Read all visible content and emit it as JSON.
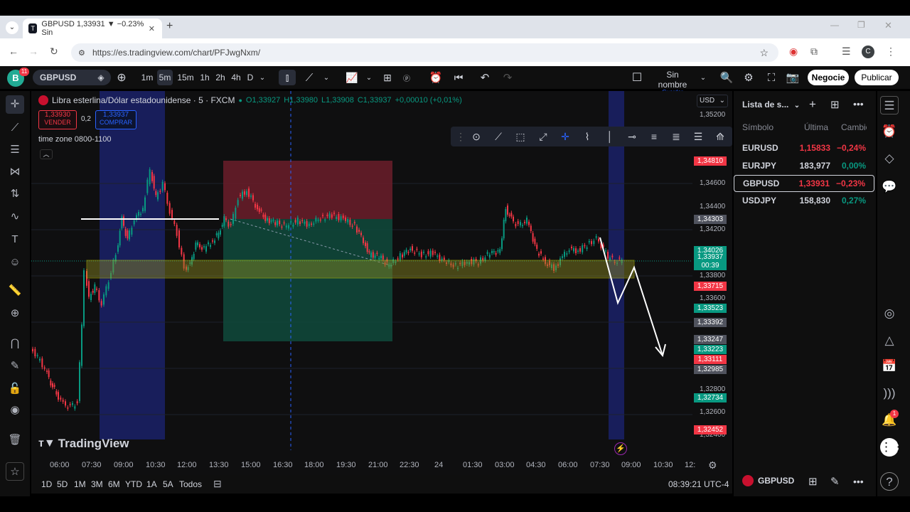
{
  "browser": {
    "tab_title": "GBPUSD 1,33931 ▼ −0.23% Sin",
    "url": "https://es.tradingview.com/chart/PFJwgNxm/",
    "profile_letter": "C"
  },
  "header": {
    "avatar_letter": "B",
    "badge_count": "11",
    "symbol": "GBPUSD",
    "intervals": [
      "1m",
      "5m",
      "15m",
      "1h",
      "2h",
      "4h",
      "D"
    ],
    "selected_interval": "5m",
    "layout_name": "Sin nombre",
    "layout_sub": "Guardar",
    "trade_button": "Negocie",
    "publish_button": "Publicar"
  },
  "chart": {
    "title": "Libra esterlina/Dólar estadounidense · 5 · FXCM",
    "ohlc": {
      "o": "O1,33927",
      "h": "H1,33980",
      "l": "L1,33908",
      "c": "C1,33937",
      "chg": "+0,00010 (+0,01%)"
    },
    "sell_price": "1,33930",
    "sell_label": "VENDER",
    "spread": "0,2",
    "buy_price": "1,33937",
    "buy_label": "COMPRAR",
    "indicator": "time zone 0800-1100",
    "currency": "USD",
    "price_ticks": [
      "1,35200",
      "1,34600",
      "1,34400",
      "1,34200",
      "1,33800",
      "1,33600",
      "1,32800",
      "1,32600",
      "1,32400"
    ],
    "price_labels": [
      {
        "text": "1,34810",
        "color": "#f23645"
      },
      {
        "text": "1,34303",
        "color": "#50535e"
      },
      {
        "text": "1,34026",
        "color": "#089981"
      },
      {
        "text": "1,33937",
        "color": "#089981"
      },
      {
        "text": "00:39",
        "color": "#089981"
      },
      {
        "text": "1,33715",
        "color": "#f23645"
      },
      {
        "text": "1,33523",
        "color": "#089981"
      },
      {
        "text": "1,33392",
        "color": "#50535e"
      },
      {
        "text": "1,33247",
        "color": "#50535e"
      },
      {
        "text": "1,33223",
        "color": "#089981"
      },
      {
        "text": "1,33111",
        "color": "#f23645"
      },
      {
        "text": "1,32985",
        "color": "#50535e"
      },
      {
        "text": "1,32734",
        "color": "#089981"
      },
      {
        "text": "1,32452",
        "color": "#f23645"
      }
    ],
    "time_labels": [
      "06:00",
      "07:30",
      "09:00",
      "10:30",
      "12:00",
      "13:30",
      "15:00",
      "16:30",
      "18:00",
      "19:30",
      "21:00",
      "22:30",
      "24",
      "01:30",
      "03:00",
      "04:30",
      "06:00",
      "07:30",
      "09:00",
      "10:30",
      "12:"
    ],
    "watermark": "TradingView"
  },
  "bottom": {
    "ranges": [
      "1D",
      "5D",
      "1M",
      "3M",
      "6M",
      "YTD",
      "1A",
      "5A",
      "Todos"
    ],
    "clock": "08:39:21 UTC-4"
  },
  "watchlist": {
    "title": "Lista de s...",
    "columns": [
      "Símbolo",
      "Última",
      "Cambio"
    ],
    "rows": [
      {
        "symbol": "EURUSD",
        "last": "1,15833",
        "change": "−0,24%",
        "color": "#f23645"
      },
      {
        "symbol": "EURJPY",
        "last": "183,977",
        "change": "0,00%",
        "color": "#089981"
      },
      {
        "symbol": "GBPUSD",
        "last": "1,33931",
        "change": "−0,23%",
        "color": "#f23645"
      },
      {
        "symbol": "USDJPY",
        "last": "158,830",
        "change": "0,27%",
        "color": "#089981"
      }
    ],
    "footer_symbol": "GBPUSD"
  }
}
